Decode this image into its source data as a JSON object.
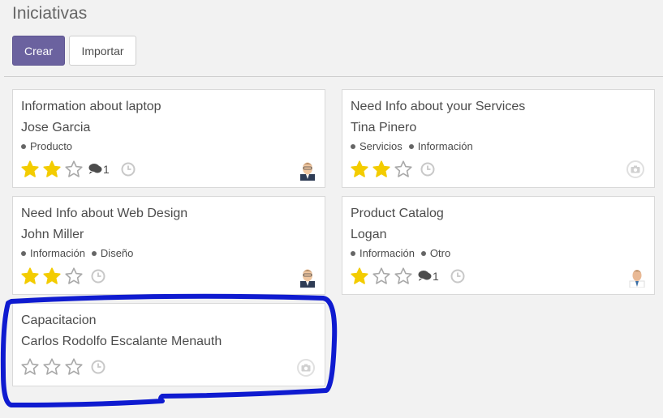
{
  "page": {
    "title": "Iniciativas"
  },
  "toolbar": {
    "create_label": "Crear",
    "import_label": "Importar"
  },
  "cards": [
    {
      "title": "Information about laptop",
      "contact": "Jose Garcia",
      "tags": [
        "Producto"
      ],
      "stars": 2,
      "messages": "1",
      "has_avatar": true
    },
    {
      "title": "Need Info about your Services",
      "contact": "Tina Pinero",
      "tags": [
        "Servicios",
        "Información"
      ],
      "stars": 2,
      "messages": "",
      "has_avatar": false
    },
    {
      "title": "Need Info about Web Design",
      "contact": "John Miller",
      "tags": [
        "Información",
        "Diseño"
      ],
      "stars": 2,
      "messages": "",
      "has_avatar": true
    },
    {
      "title": "Product Catalog",
      "contact": "Logan",
      "tags": [
        "Información",
        "Otro"
      ],
      "stars": 1,
      "messages": "1",
      "has_avatar": true
    },
    {
      "title": "Capacitacion",
      "contact": "Carlos Rodolfo Escalante Menauth",
      "tags": [],
      "stars": 0,
      "messages": "",
      "has_avatar": false
    }
  ],
  "colors": {
    "primary": "#6b629f",
    "star_filled": "#f3cc00",
    "star_empty": "#a8a8a8",
    "highlight": "#0f1bd0"
  }
}
